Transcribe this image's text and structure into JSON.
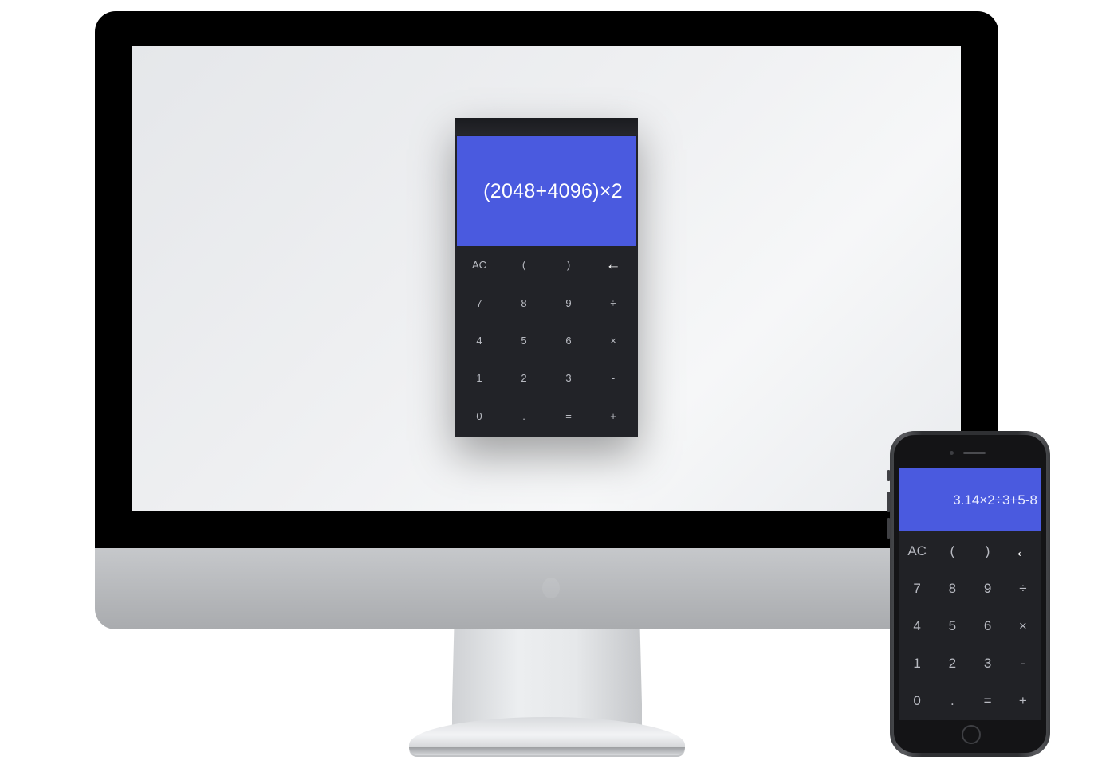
{
  "desktop_calculator": {
    "display": "(2048+4096)×2",
    "keys": [
      "AC",
      "(",
      ")",
      "←",
      "7",
      "8",
      "9",
      "÷",
      "4",
      "5",
      "6",
      "×",
      "1",
      "2",
      "3",
      "-",
      "0",
      ".",
      "=",
      "+"
    ]
  },
  "mobile_calculator": {
    "display": "3.14×2÷3+5-8",
    "keys": [
      "AC",
      "(",
      ")",
      "←",
      "7",
      "8",
      "9",
      "÷",
      "4",
      "5",
      "6",
      "×",
      "1",
      "2",
      "3",
      "-",
      "0",
      ".",
      "=",
      "+"
    ]
  },
  "colors": {
    "display_blue": "#4a5adf",
    "keypad_dark": "#222328"
  },
  "icons": {
    "backspace": "left-arrow"
  }
}
